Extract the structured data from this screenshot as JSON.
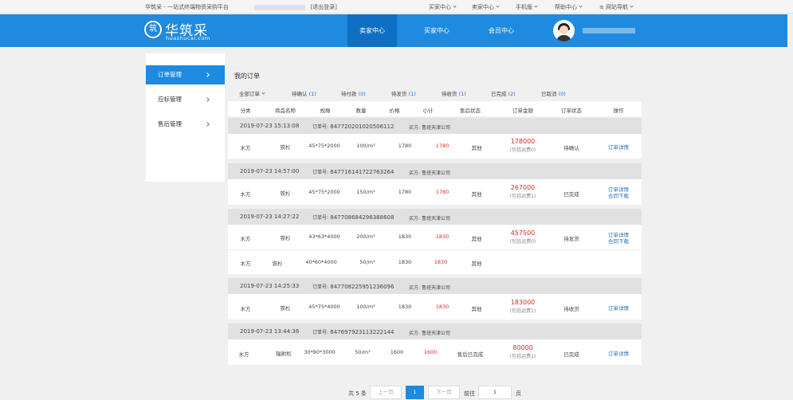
{
  "topbar": {
    "site_title": "华筑采 - 一站式终端物资采购平台",
    "logout": "[退出登录]",
    "menus": [
      "买家中心",
      "卖家中心",
      "手机版",
      "帮助中心",
      "网站导航"
    ]
  },
  "header": {
    "logo_cn": "华筑采",
    "logo_en": "huazhucai.com",
    "logo_mark": "筑",
    "nav": [
      "卖家中心",
      "买家中心",
      "会员中心"
    ]
  },
  "sidebar": {
    "items": [
      "订单管理",
      "应标管理",
      "售后管理"
    ]
  },
  "main": {
    "title": "我的订单",
    "tabs": [
      {
        "label": "全部订单",
        "count": ""
      },
      {
        "label": "待确认",
        "count": "(1)"
      },
      {
        "label": "待付款",
        "count": "(0)"
      },
      {
        "label": "待发货",
        "count": "(1)"
      },
      {
        "label": "待收货",
        "count": "(1)"
      },
      {
        "label": "已完成",
        "count": "(2)"
      },
      {
        "label": "已取消",
        "count": "(0)"
      }
    ],
    "columns": [
      "分类",
      "商品名称",
      "规格",
      "数量",
      "价格",
      "小计",
      "售后状态",
      "订单金额",
      "订单状态",
      "操作"
    ],
    "order_no_label": "订单号:",
    "buyer_label": "买方:",
    "orders": [
      {
        "date": "2019-07-23 15:13:08",
        "order_no": "847720201020506112",
        "buyer": "鲁班天津公司",
        "items": [
          {
            "category": "木方",
            "name": "铁杉",
            "spec": "45*75*2000",
            "qty": "100/m³",
            "price": "1780",
            "subtotal": "1780",
            "after_sale": "其他"
          }
        ],
        "amount": "178000",
        "freight": "(包括运费0)",
        "status": "待确认",
        "actions": [
          "订单详情"
        ]
      },
      {
        "date": "2019-07-23 14:57:00",
        "order_no": "847716141722763264",
        "buyer": "鲁班天津公司",
        "items": [
          {
            "category": "木方",
            "name": "铁杉",
            "spec": "45*75*2000",
            "qty": "150/m³",
            "price": "1780",
            "subtotal": "1780",
            "after_sale": "其他"
          }
        ],
        "amount": "267000",
        "freight": "(包括运费1)",
        "status": "已完成",
        "actions": [
          "订单详情",
          "合同下载"
        ]
      },
      {
        "date": "2019-07-23 14:27:22",
        "order_no": "847708684296388608",
        "buyer": "鲁班天津公司",
        "items": [
          {
            "category": "木方",
            "name": "铁杉",
            "spec": "43*63*4000",
            "qty": "200/m³",
            "price": "1830",
            "subtotal": "1830",
            "after_sale": "其他"
          },
          {
            "category": "木方",
            "name": "铁杉",
            "spec": "40*60*4000",
            "qty": "50/m³",
            "price": "1830",
            "subtotal": "1830",
            "after_sale": "其他"
          }
        ],
        "amount": "457500",
        "freight": "(包括运费0)",
        "status": "待发货",
        "actions": [
          "订单详情",
          "合同下载"
        ]
      },
      {
        "date": "2019-07-23 14:25:33",
        "order_no": "847708225951236096",
        "buyer": "鲁班天津公司",
        "items": [
          {
            "category": "木方",
            "name": "铁杉",
            "spec": "45*75*4000",
            "qty": "100/m³",
            "price": "1830",
            "subtotal": "1830",
            "after_sale": "其他"
          }
        ],
        "amount": "183000",
        "freight": "(包括运费1)",
        "status": "待收货",
        "actions": [
          "订单详情"
        ]
      },
      {
        "date": "2019-07-23 13:44:36",
        "order_no": "847697923113222144",
        "buyer": "鲁班天津公司",
        "items": [
          {
            "category": "木方",
            "name": "辐射松",
            "spec": "30*80*3000",
            "qty": "50/m³",
            "price": "1600",
            "subtotal": "1600",
            "after_sale": "售后已完成"
          }
        ],
        "amount": "80000",
        "freight": "(包括运费1)",
        "status": "已完成",
        "actions": [
          "订单详情"
        ]
      }
    ]
  },
  "pager": {
    "total": "共 5 条",
    "prev": "上一页",
    "current": "1",
    "next": "下一页",
    "goto": "前往",
    "goto_value": "1",
    "page_unit": "页"
  }
}
